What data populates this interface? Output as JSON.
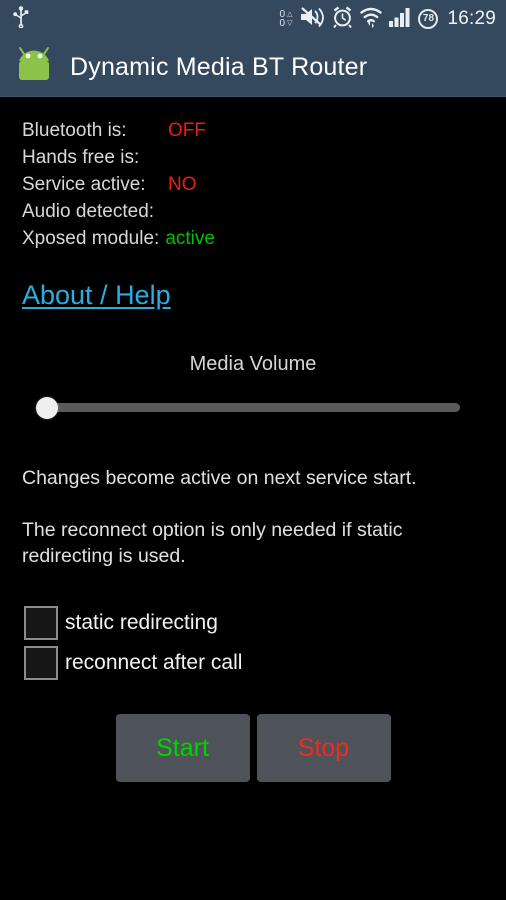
{
  "statusbar": {
    "usb_icon": "usb-icon",
    "data_up": "0",
    "data_down": "0",
    "caret_up": "△",
    "caret_down": "▽",
    "mute_icon": "volume-muted-icon",
    "alarm_icon": "alarm-clock-icon",
    "wifi_icon": "wifi-icon",
    "signal_icon": "cellular-signal-icon",
    "battery_percent": "78",
    "time": "16:29"
  },
  "titlebar": {
    "app_icon": "android-robot-icon",
    "title": "Dynamic Media BT Router",
    "background_color": "#34495e"
  },
  "status": {
    "rows": [
      {
        "label": "Bluetooth is:",
        "value": "OFF",
        "value_color": "#e81f12"
      },
      {
        "label": "Hands free is:",
        "value": "",
        "value_color": "#e81f12"
      },
      {
        "label": "Service active:",
        "value": "NO",
        "value_color": "#e81f12"
      },
      {
        "label": "Audio detected:",
        "value": "",
        "value_color": "#e81f12"
      },
      {
        "label": "Xposed module:",
        "value": "active",
        "value_color": "#00c000"
      }
    ]
  },
  "about": {
    "link_label": "About / Help",
    "link_color": "#2aaee0"
  },
  "volume": {
    "title": "Media Volume",
    "value": 0,
    "min": 0,
    "max": 100
  },
  "info": {
    "line1": "Changes become active on next service start.",
    "line2": "The reconnect option is only needed if static redirecting is used."
  },
  "options": [
    {
      "label": "static redirecting",
      "checked": false
    },
    {
      "label": "reconnect after call",
      "checked": false
    }
  ],
  "buttons": {
    "start_label": "Start",
    "start_color": "#00d400",
    "stop_label": "Stop",
    "stop_color": "#ef2b22",
    "background_color": "#4d5358"
  }
}
